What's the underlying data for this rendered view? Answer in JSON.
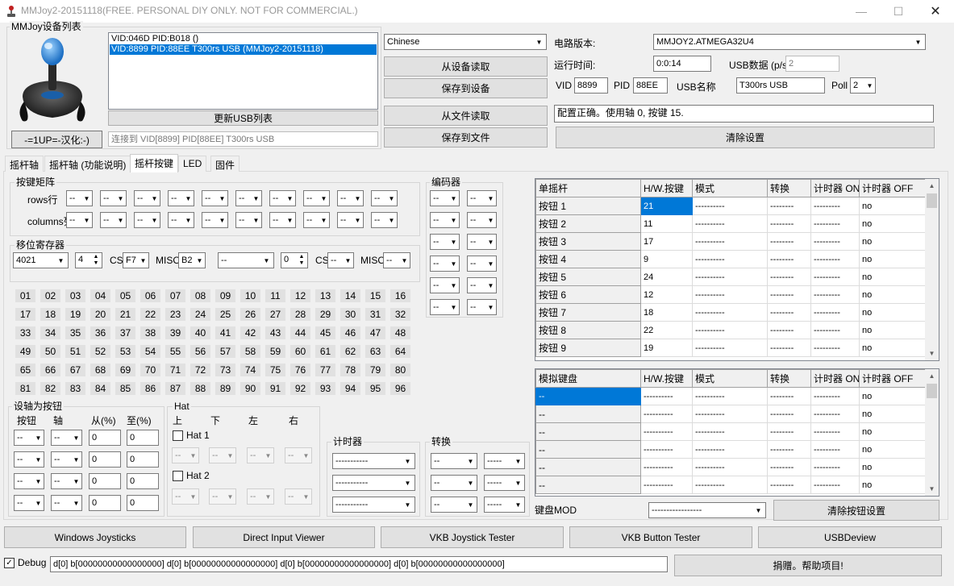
{
  "window": {
    "title": "MMJoy2-20151118(FREE. PERSONAL DIY ONLY. NOT FOR COMMERCIAL.)"
  },
  "devices": {
    "group_label": "MMJoy设备列表",
    "list": [
      "VID:046D PID:B018 ()",
      "VID:8899 PID:88EE T300rs USB (MMJoy2-20151118)"
    ],
    "refresh_button": "更新USB列表",
    "lang_button": "-=1UP=-汉化:-)",
    "status": "连接到 VID[8899] PID[88EE] T300rs USB"
  },
  "top": {
    "language": "Chinese",
    "read_device": "从设备读取",
    "save_device": "保存到设备",
    "read_file": "从文件读取",
    "save_file": "保存到文件",
    "board_label": "电路版本:",
    "board_value": "MMJOY2.ATMEGA32U4",
    "uptime_label": "运行时间:",
    "uptime_value": "0:0:14",
    "usbdata_label": "USB数据 (p/s",
    "usbdata_value": "2",
    "vid_label": "VID",
    "vid_value": "8899",
    "pid_label": "PID",
    "pid_value": "88EE",
    "usbname_label": "USB名称",
    "usbname_value": "T300rs USB",
    "poll_label": "Poll",
    "poll_value": "2",
    "message": "配置正确。使用轴 0, 按键 15.",
    "clear_button": "清除设置"
  },
  "tabs": [
    "摇杆轴",
    "摇杆轴 (功能说明)",
    "摇杆按键",
    "LED",
    "固件"
  ],
  "matrix": {
    "label": "按键矩阵",
    "rows_label": "rows行",
    "cols_label": "columns列",
    "cell": "--"
  },
  "shift": {
    "label": "移位寄存器",
    "chip1": "4021",
    "count1": "4",
    "cs_label": "CS",
    "cs1": "F7",
    "miso_label": "MISO",
    "miso1": "B2",
    "chip2": "--",
    "count2": "0",
    "cs2": "--",
    "miso2": "--"
  },
  "encoder": {
    "label": "编码器",
    "cell": "--"
  },
  "button_numbers": [
    "01",
    "02",
    "03",
    "04",
    "05",
    "06",
    "07",
    "08",
    "09",
    "10",
    "11",
    "12",
    "13",
    "14",
    "15",
    "16",
    "17",
    "18",
    "19",
    "20",
    "21",
    "22",
    "23",
    "24",
    "25",
    "26",
    "27",
    "28",
    "29",
    "30",
    "31",
    "32",
    "33",
    "34",
    "35",
    "36",
    "37",
    "38",
    "39",
    "40",
    "41",
    "42",
    "43",
    "44",
    "45",
    "46",
    "47",
    "48",
    "49",
    "50",
    "51",
    "52",
    "53",
    "54",
    "55",
    "56",
    "57",
    "58",
    "59",
    "60",
    "61",
    "62",
    "63",
    "64",
    "65",
    "66",
    "67",
    "68",
    "69",
    "70",
    "71",
    "72",
    "73",
    "74",
    "75",
    "76",
    "77",
    "78",
    "79",
    "80",
    "81",
    "82",
    "83",
    "84",
    "85",
    "86",
    "87",
    "88",
    "89",
    "90",
    "91",
    "92",
    "93",
    "94",
    "95",
    "96"
  ],
  "axis_btn": {
    "label": "设轴为按钮",
    "h_button": "按钮",
    "h_axis": "轴",
    "h_from": "从(%)",
    "h_to": "至(%)",
    "cell": "--",
    "num": "0"
  },
  "hat": {
    "label": "Hat",
    "up": "上",
    "down": "下",
    "left": "左",
    "right": "右",
    "hat1": "Hat 1",
    "hat2": "Hat 2",
    "cell": "--"
  },
  "timer": {
    "label": "计时器",
    "cell": "-----------"
  },
  "convert": {
    "label": "转换",
    "cell": "--",
    "cell2": "-----"
  },
  "joy_table": {
    "headers": [
      "单摇杆",
      "H/W.按键",
      "模式",
      "转换",
      "计时器 ON",
      "计时器 OFF"
    ],
    "rows": [
      {
        "name": "按钮 1",
        "hw": "21",
        "mode": "----------",
        "conv": "--------",
        "ton": "---------",
        "toff": "no"
      },
      {
        "name": "按钮 2",
        "hw": "11",
        "mode": "----------",
        "conv": "--------",
        "ton": "---------",
        "toff": "no"
      },
      {
        "name": "按钮 3",
        "hw": "17",
        "mode": "----------",
        "conv": "--------",
        "ton": "---------",
        "toff": "no"
      },
      {
        "name": "按钮 4",
        "hw": "9",
        "mode": "----------",
        "conv": "--------",
        "ton": "---------",
        "toff": "no"
      },
      {
        "name": "按钮 5",
        "hw": "24",
        "mode": "----------",
        "conv": "--------",
        "ton": "---------",
        "toff": "no"
      },
      {
        "name": "按钮 6",
        "hw": "12",
        "mode": "----------",
        "conv": "--------",
        "ton": "---------",
        "toff": "no"
      },
      {
        "name": "按钮 7",
        "hw": "18",
        "mode": "----------",
        "conv": "--------",
        "ton": "---------",
        "toff": "no"
      },
      {
        "name": "按钮 8",
        "hw": "22",
        "mode": "----------",
        "conv": "--------",
        "ton": "---------",
        "toff": "no"
      },
      {
        "name": "按钮 9",
        "hw": "19",
        "mode": "----------",
        "conv": "--------",
        "ton": "---------",
        "toff": "no"
      }
    ]
  },
  "kb_table": {
    "headers": [
      "模拟键盘",
      "H/W.按键",
      "模式",
      "转换",
      "计时器 ON",
      "计时器 OFF"
    ],
    "rows": [
      {
        "name": "--",
        "hw": "----------",
        "mode": "----------",
        "conv": "--------",
        "ton": "---------",
        "toff": "no"
      },
      {
        "name": "--",
        "hw": "----------",
        "mode": "----------",
        "conv": "--------",
        "ton": "---------",
        "toff": "no"
      },
      {
        "name": "--",
        "hw": "----------",
        "mode": "----------",
        "conv": "--------",
        "ton": "---------",
        "toff": "no"
      },
      {
        "name": "--",
        "hw": "----------",
        "mode": "----------",
        "conv": "--------",
        "ton": "---------",
        "toff": "no"
      },
      {
        "name": "--",
        "hw": "----------",
        "mode": "----------",
        "conv": "--------",
        "ton": "---------",
        "toff": "no"
      },
      {
        "name": "--",
        "hw": "----------",
        "mode": "----------",
        "conv": "--------",
        "ton": "---------",
        "toff": "no"
      }
    ]
  },
  "kbmod": {
    "label": "键盘MOD",
    "value": "-----------------",
    "clear_button": "清除按钮设置"
  },
  "tools": [
    "Windows Joysticks",
    "Direct Input Viewer",
    "VKB Joystick Tester",
    "VKB Button Tester",
    "USBDeview"
  ],
  "debug": {
    "label": "Debug",
    "text": "d[0] b[00000000000000000]   d[0] b[00000000000000000]   d[0] b[00000000000000000]   d[0] b[00000000000000000]",
    "donate": "捐赠。帮助项目!"
  },
  "icons": {
    "app": "joystick-icon",
    "min": "minimize-icon",
    "max": "maximize-icon",
    "close": "close-icon",
    "check": "✓"
  },
  "colors": {
    "selection": "#0078d7",
    "accent_blue": "#3aa0ff"
  }
}
